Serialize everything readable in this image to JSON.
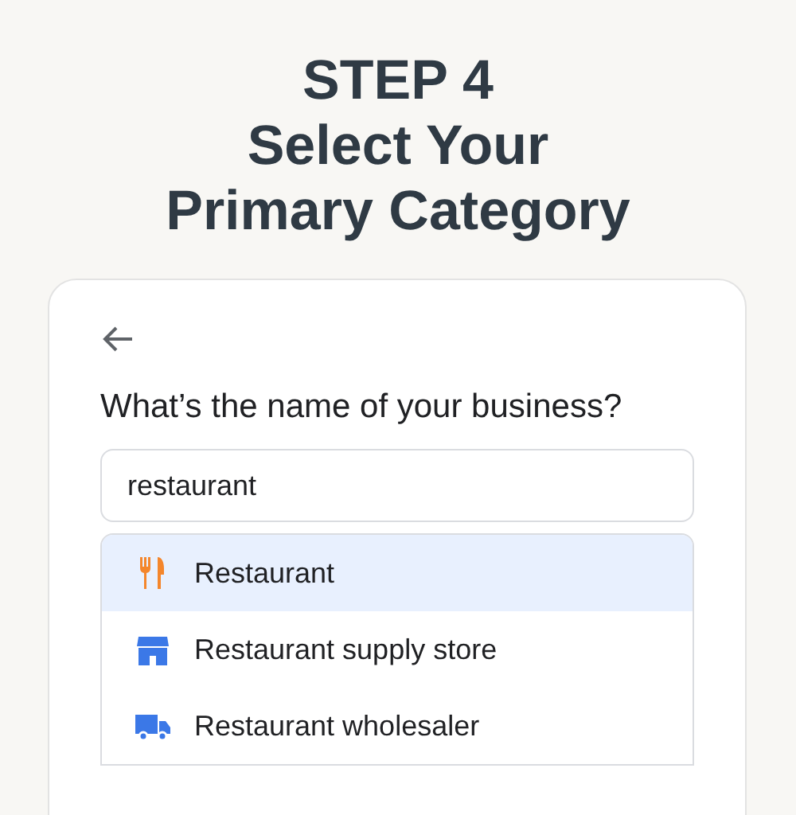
{
  "heading": {
    "lines": [
      "STEP 4",
      "Select Your",
      "Primary Category"
    ]
  },
  "form": {
    "question": "What’s the name of your business?",
    "input": {
      "value": "restaurant"
    },
    "suggestions": [
      {
        "label": "Restaurant",
        "kind": "food",
        "selected": true
      },
      {
        "label": "Restaurant supply store",
        "kind": "store",
        "selected": false
      },
      {
        "label": "Restaurant wholesaler",
        "kind": "truck",
        "selected": false
      }
    ]
  }
}
